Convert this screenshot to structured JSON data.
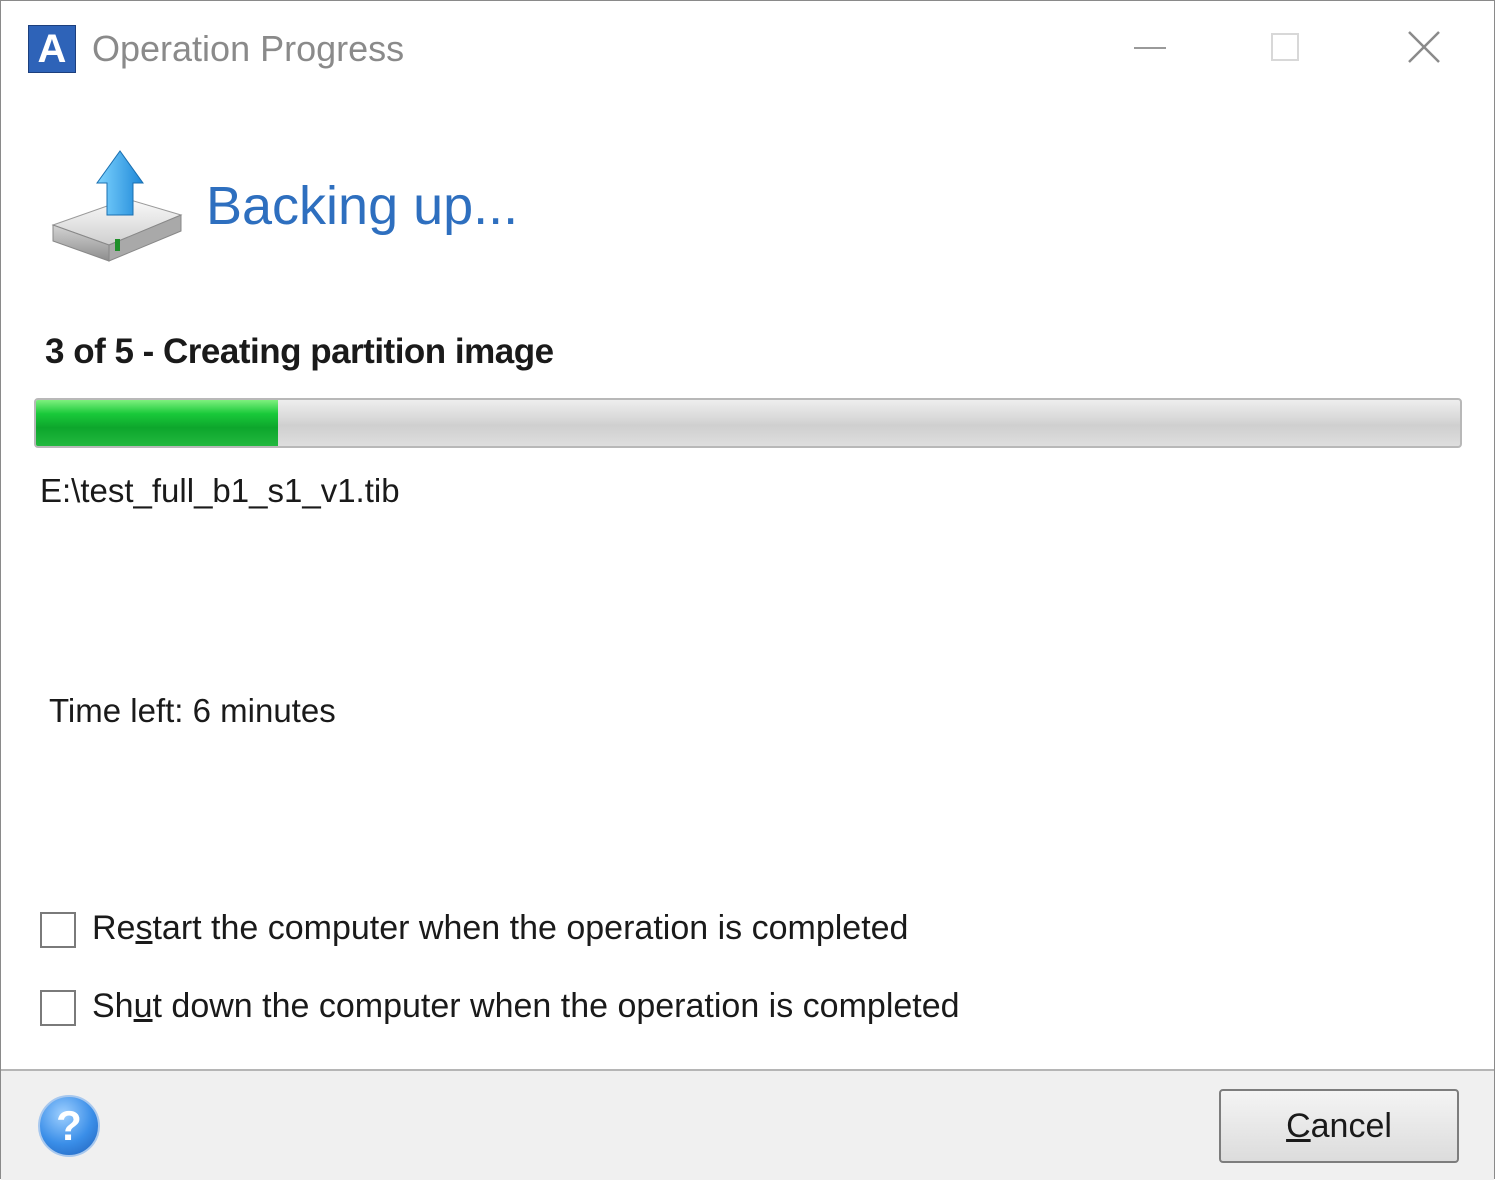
{
  "window": {
    "title": "Operation Progress",
    "logo_letter": "A"
  },
  "header": {
    "title": "Backing up..."
  },
  "progress": {
    "step_text": "3 of 5 - Creating partition image",
    "fraction": 0.17,
    "fill_color": "#19c93a",
    "file_path": "E:\\test_full_b1_s1_v1.tib",
    "time_left": "Time left: 6 minutes"
  },
  "options": {
    "restart": {
      "label_pre": "Re",
      "label_mnemonic": "s",
      "label_post": "tart the computer when the operation is completed",
      "checked": false
    },
    "shutdown": {
      "label_pre": "Sh",
      "label_mnemonic": "u",
      "label_post": "t down the computer when the operation is completed",
      "checked": false
    }
  },
  "footer": {
    "help_glyph": "?",
    "cancel_mnemonic": "C",
    "cancel_rest": "ancel"
  },
  "colors": {
    "header_blue": "#2e6fbf",
    "logo_blue": "#2e63b8"
  }
}
